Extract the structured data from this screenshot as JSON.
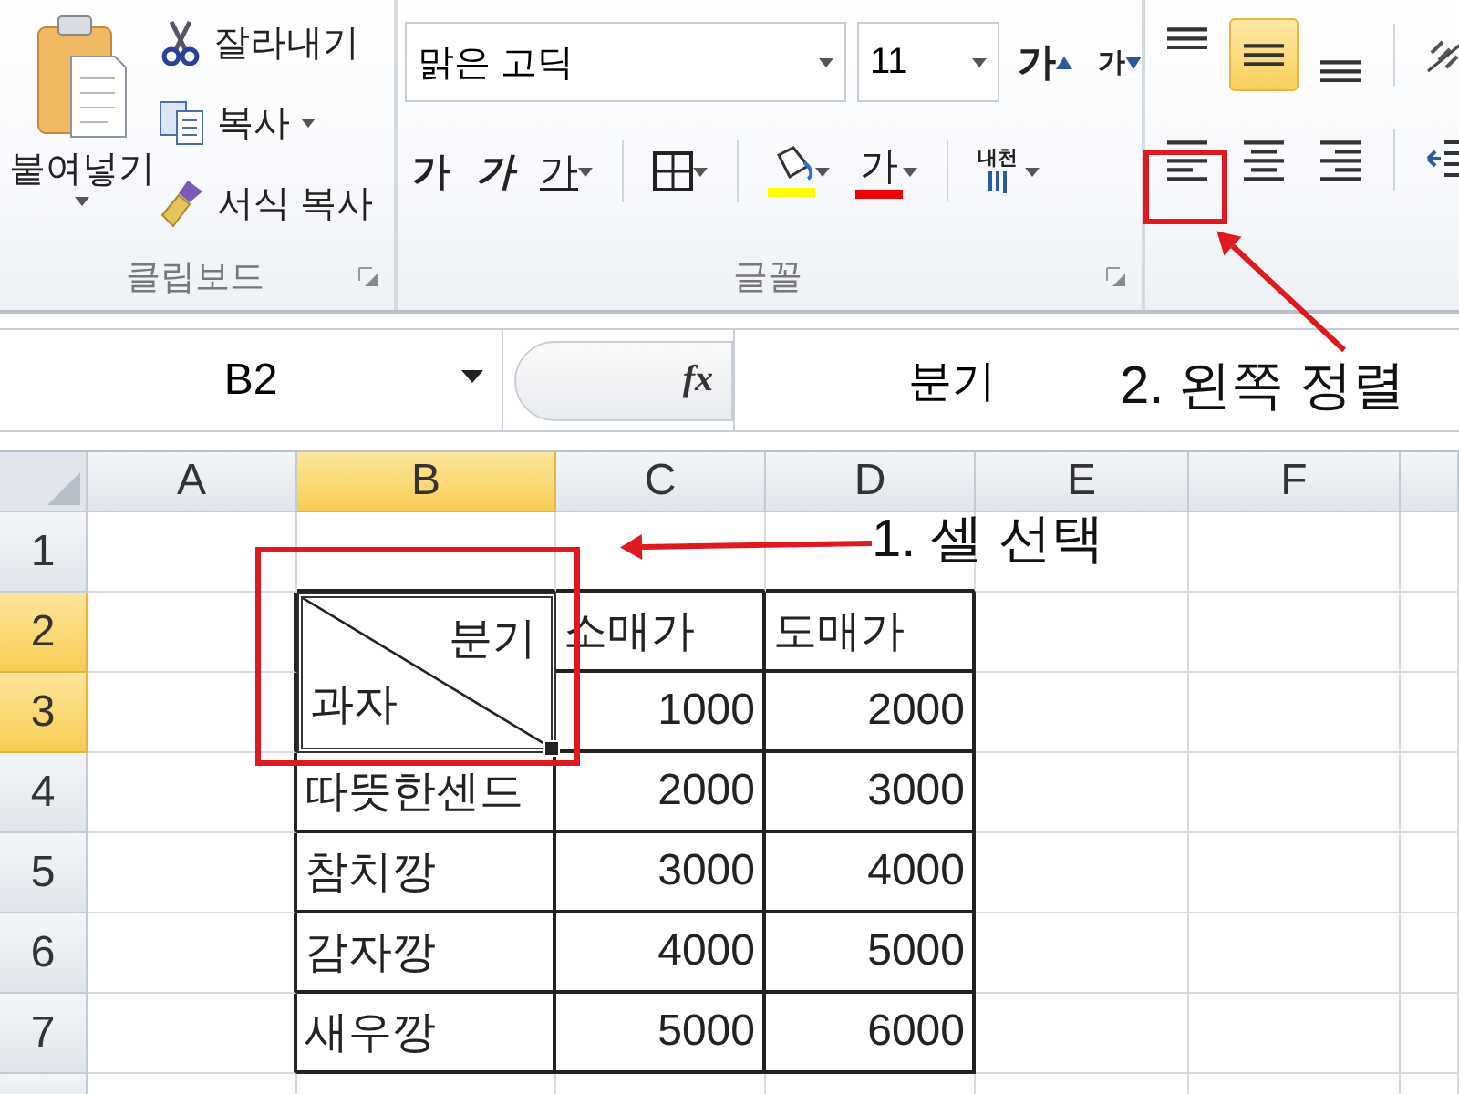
{
  "ribbon": {
    "clipboard": {
      "paste": "붙여넣기",
      "cut": "잘라내기",
      "copy": "복사",
      "format_painter": "서식 복사",
      "label": "클립보드"
    },
    "font": {
      "font_name": "맑은 고딕",
      "font_size": "11",
      "grow_font": "가",
      "shrink_font": "가",
      "bold": "가",
      "italic": "가",
      "underline": "가",
      "font_color": "가",
      "phonetic": "내천",
      "label": "글꼴"
    },
    "alignment": {
      "vertical": [
        {
          "kind": "top",
          "selected": false
        },
        {
          "kind": "middle",
          "selected": true
        },
        {
          "kind": "bottom",
          "selected": false
        }
      ],
      "horizontal": [
        {
          "kind": "left",
          "selected": false
        },
        {
          "kind": "center",
          "selected": false
        },
        {
          "kind": "right",
          "selected": false
        }
      ]
    }
  },
  "formula_bar": {
    "name_box": "B2",
    "fx": "fx",
    "formula": "분기"
  },
  "sheet": {
    "columns": [
      {
        "label": "A",
        "selected": false
      },
      {
        "label": "B",
        "selected": true
      },
      {
        "label": "C",
        "selected": false
      },
      {
        "label": "D",
        "selected": false
      },
      {
        "label": "E",
        "selected": false
      },
      {
        "label": "F",
        "selected": false
      }
    ],
    "rows": [
      {
        "label": "1",
        "selected": false
      },
      {
        "label": "2",
        "selected": true
      },
      {
        "label": "3",
        "selected": true
      },
      {
        "label": "4",
        "selected": false
      },
      {
        "label": "5",
        "selected": false
      },
      {
        "label": "6",
        "selected": false
      },
      {
        "label": "7",
        "selected": false
      }
    ],
    "diagonal_cell": {
      "top_right": "분기",
      "bottom_left": "과자"
    },
    "headers": [
      "소매가",
      "도매가"
    ],
    "first_row_values": [
      "1000",
      "2000"
    ],
    "data_rows": [
      {
        "name": "따뜻한센드",
        "values": [
          "2000",
          "3000"
        ]
      },
      {
        "name": "참치깡",
        "values": [
          "3000",
          "4000"
        ]
      },
      {
        "name": "감자깡",
        "values": [
          "4000",
          "5000"
        ]
      },
      {
        "name": "새우깡",
        "values": [
          "5000",
          "6000"
        ]
      }
    ]
  },
  "annotations": [
    {
      "kind": "cell",
      "text": "1. 셀 선택"
    },
    {
      "kind": "button",
      "text": "2. 왼쪽 정렬"
    }
  ]
}
